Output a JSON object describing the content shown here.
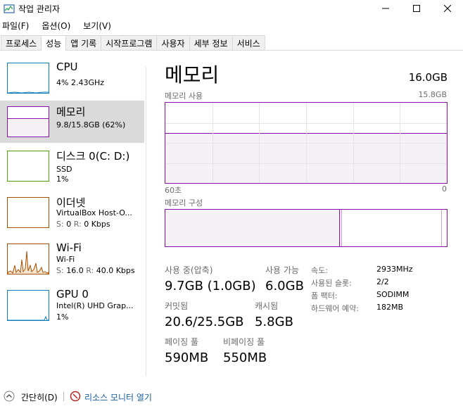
{
  "window": {
    "title": "작업 관리자",
    "icons": {
      "app": "task-manager-icon",
      "minimize": "minimize-icon",
      "maximize": "maximize-icon",
      "close": "close-icon"
    }
  },
  "menu": [
    "파일(F)",
    "옵션(O)",
    "보기(V)"
  ],
  "tabs": [
    "프로세스",
    "성능",
    "앱 기록",
    "시작프로그램",
    "사용자",
    "세부 정보",
    "서비스"
  ],
  "active_tab": "성능",
  "sidebar": {
    "items": [
      {
        "title": "CPU",
        "sub1": "4% 2.43GHz",
        "sub2": "",
        "color": "#117dbb"
      },
      {
        "title": "메모리",
        "sub1": "9.8/15.8GB (62%)",
        "sub2": "",
        "color": "#8b12ae"
      },
      {
        "title": "디스크 0(C: D:)",
        "sub1": "SSD",
        "sub2": "1%",
        "color": "#4da60c"
      },
      {
        "title": "이더넷",
        "sub1": "VirtualBox Host-O...",
        "sub2_s_label": "S:",
        "sub2_s_value": "0",
        "sub2_r_label": "R:",
        "sub2_r_value": "0 Kbps",
        "color": "#a74f01"
      },
      {
        "title": "Wi-Fi",
        "sub1": "Wi-Fi",
        "sub2_s_label": "S:",
        "sub2_s_value": "16.0",
        "sub2_r_label": "R:",
        "sub2_r_value": "40.0 Kbps",
        "color": "#a74f01"
      },
      {
        "title": "GPU 0",
        "sub1": "Intel(R) UHD Grap...",
        "sub2": "1%",
        "color": "#117dbb"
      }
    ]
  },
  "main": {
    "title": "메모리",
    "total": "16.0GB",
    "usage_label": "메모리 사용",
    "usage_max": "15.8GB",
    "axis_left": "60초",
    "axis_right": "0",
    "composition_label": "메모리 구성",
    "usage_fraction": 0.62,
    "composition": {
      "in_use_fraction": 0.62,
      "standby_fraction": 0.98
    },
    "accent": "#8b12ae",
    "stats": {
      "in_use_label": "사용 중(압축)",
      "in_use_value": "9.7GB (1.0GB)",
      "available_label": "사용 가능",
      "available_value": "6.0GB",
      "committed_label": "커밋됨",
      "committed_value": "20.6/25.5GB",
      "cached_label": "캐시됨",
      "cached_value": "5.8GB",
      "paged_label": "페이징 풀",
      "paged_value": "590MB",
      "nonpaged_label": "비페이징 풀",
      "nonpaged_value": "550MB"
    },
    "details": [
      {
        "label": "속도:",
        "value": "2933MHz"
      },
      {
        "label": "사용된 슬롯:",
        "value": "2/2"
      },
      {
        "label": "폼 팩터:",
        "value": "SODIMM"
      },
      {
        "label": "하드웨어 예약:",
        "value": "182MB"
      }
    ]
  },
  "footer": {
    "less_details": "간단히(D)",
    "resource_monitor": "리소스 모니터 열기",
    "icons": {
      "chevron": "chevron-up-icon",
      "monitor": "resource-monitor-icon"
    }
  }
}
